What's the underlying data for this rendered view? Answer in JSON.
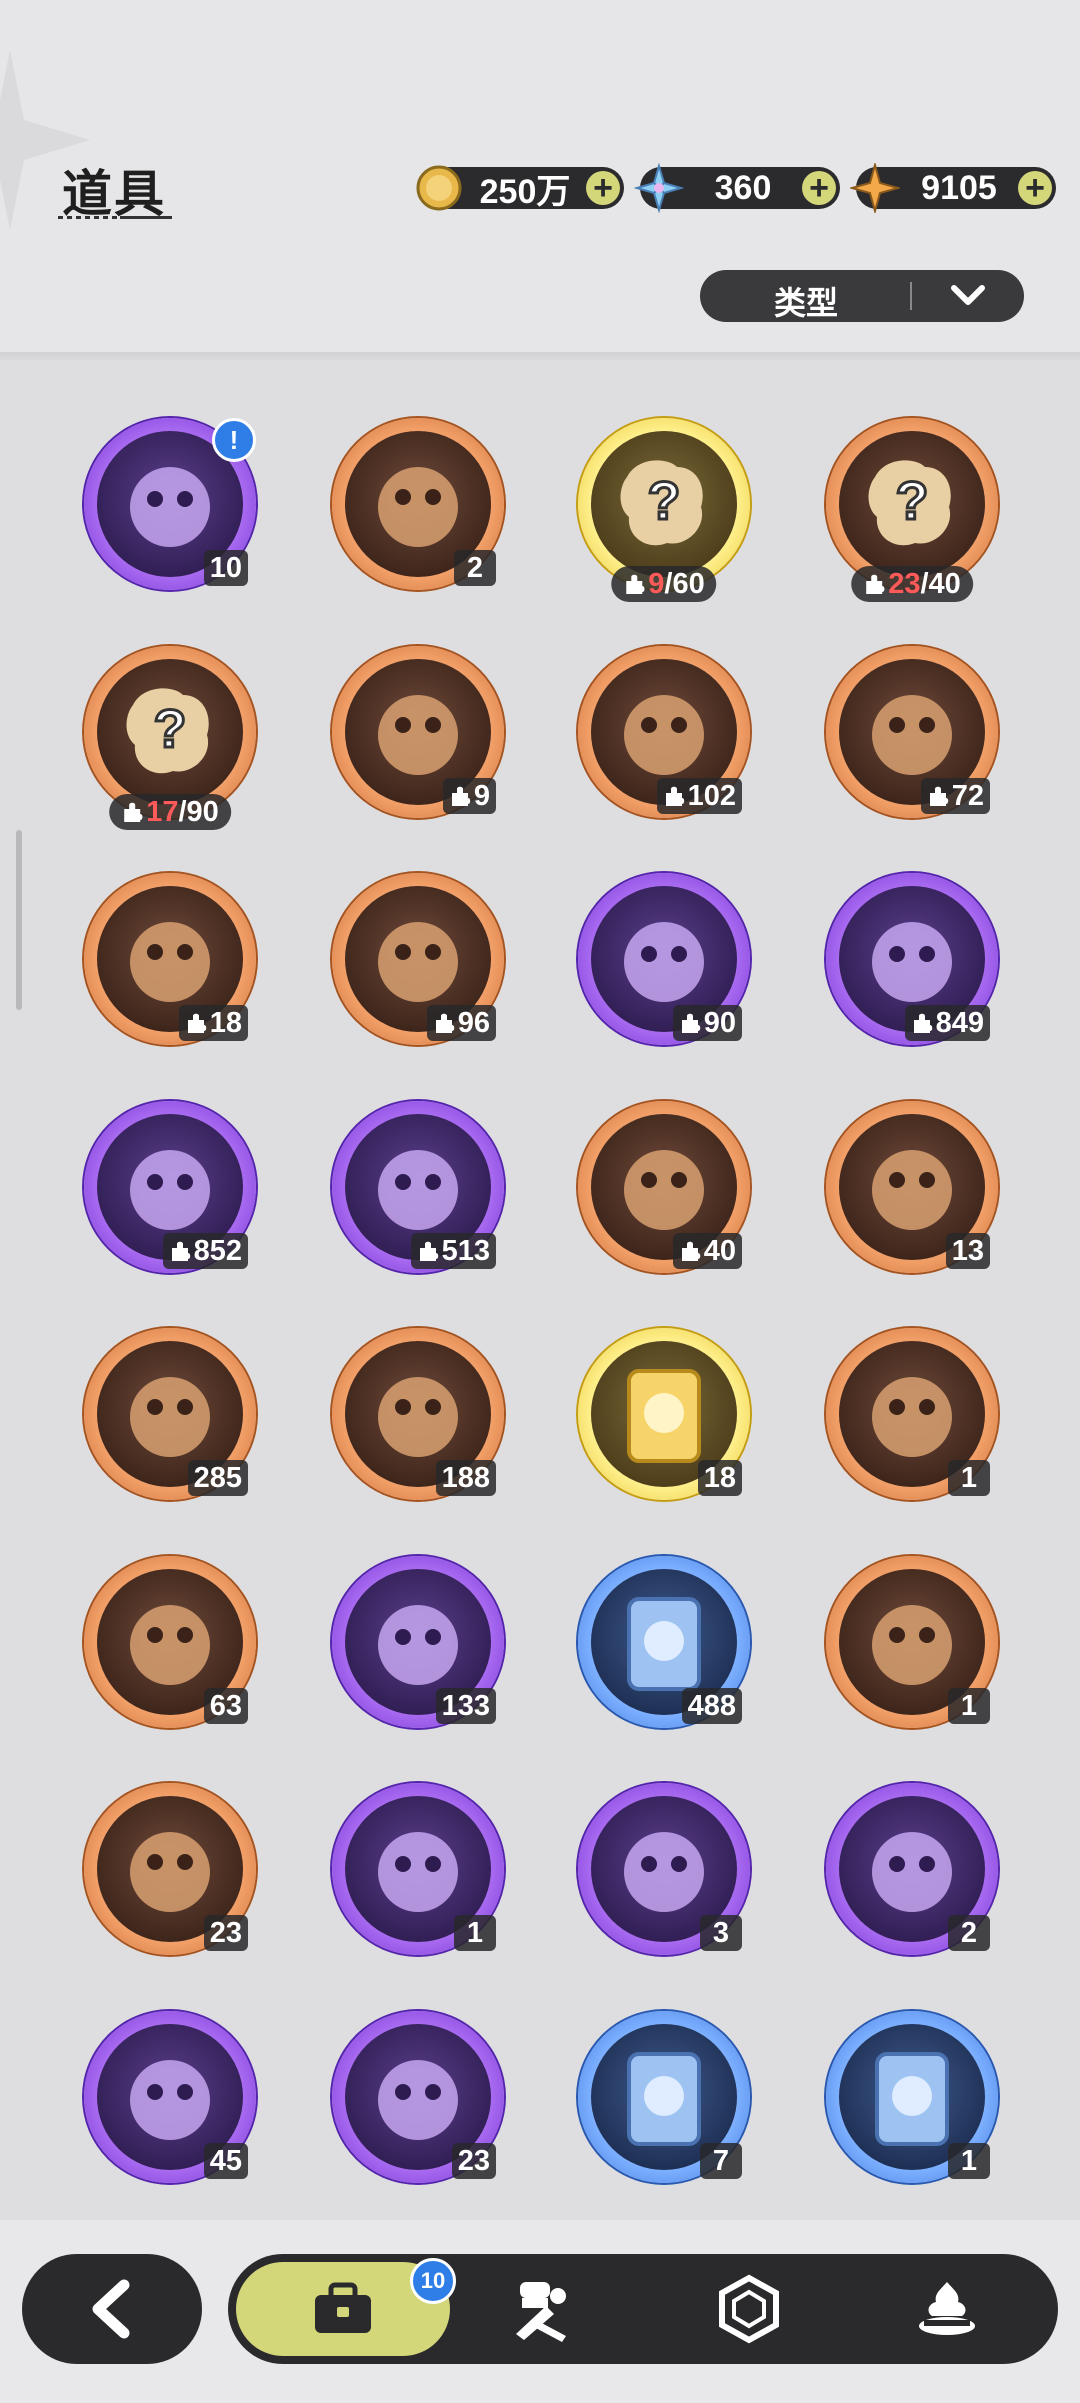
{
  "header": {
    "title": "道具",
    "currencies": [
      {
        "icon": "gold-coin-icon",
        "value": "250万"
      },
      {
        "icon": "crystal-flower-icon",
        "value": "360"
      },
      {
        "icon": "gold-star-icon",
        "value": "9105"
      }
    ],
    "filter_label": "类型"
  },
  "items": [
    {
      "name": "music-chest",
      "rarity": "purple",
      "count": "10",
      "alert": "!"
    },
    {
      "name": "purple-crystal-shard",
      "rarity": "orange",
      "count": "2"
    },
    {
      "name": "mystery-fragment-gold",
      "rarity": "gold",
      "frag_have": "9",
      "frag_need": "/60"
    },
    {
      "name": "mystery-fragment-orange",
      "rarity": "orange",
      "frag_have": "23",
      "frag_need": "/40"
    },
    {
      "name": "mystery-fragment-brown",
      "rarity": "orange",
      "frag_have": "17",
      "frag_need": "/90"
    },
    {
      "name": "teddy-fragment",
      "rarity": "orange",
      "count": "9",
      "puzzle": true
    },
    {
      "name": "knight-fragment",
      "rarity": "orange",
      "count": "102",
      "puzzle": true
    },
    {
      "name": "white-cat-fragment",
      "rarity": "orange",
      "count": "72",
      "puzzle": true
    },
    {
      "name": "dark-bear-fragment",
      "rarity": "orange",
      "count": "18",
      "puzzle": true
    },
    {
      "name": "lilac-mouse-fragment",
      "rarity": "orange",
      "count": "96",
      "puzzle": true
    },
    {
      "name": "shadow-cat-fragment",
      "rarity": "purple",
      "count": "90",
      "puzzle": true
    },
    {
      "name": "frog-bear-fragment",
      "rarity": "purple",
      "count": "849",
      "puzzle": true
    },
    {
      "name": "brown-bear-fragment",
      "rarity": "purple",
      "count": "852",
      "puzzle": true
    },
    {
      "name": "chick-fragment",
      "rarity": "purple",
      "count": "513",
      "puzzle": true
    },
    {
      "name": "tiger-fragment",
      "rarity": "orange",
      "count": "40",
      "puzzle": true
    },
    {
      "name": "pink-star-crystal",
      "rarity": "orange",
      "count": "13"
    },
    {
      "name": "blue-star-crystal",
      "rarity": "orange",
      "count": "285"
    },
    {
      "name": "paw-medallion",
      "rarity": "orange",
      "count": "188"
    },
    {
      "name": "gold-character-card",
      "rarity": "gold",
      "count": "18"
    },
    {
      "name": "rainbow-character-card",
      "rarity": "orange",
      "count": "1"
    },
    {
      "name": "orange-character-card",
      "rarity": "orange",
      "count": "63"
    },
    {
      "name": "purple-character-card",
      "rarity": "purple",
      "count": "133"
    },
    {
      "name": "blue-character-card",
      "rarity": "blue",
      "count": "488"
    },
    {
      "name": "swap-card",
      "rarity": "orange",
      "count": "1"
    },
    {
      "name": "clover-card",
      "rarity": "orange",
      "count": "23"
    },
    {
      "name": "gift-box",
      "rarity": "purple",
      "count": "1"
    },
    {
      "name": "gold-pouch",
      "rarity": "purple",
      "count": "3"
    },
    {
      "name": "magic-mirror",
      "rarity": "purple",
      "count": "2"
    },
    {
      "name": "scroll",
      "rarity": "purple",
      "count": "45"
    },
    {
      "name": "peach",
      "rarity": "purple",
      "count": "23"
    },
    {
      "name": "shovel",
      "rarity": "blue",
      "count": "7"
    },
    {
      "name": "boxing-glove",
      "rarity": "blue",
      "count": "1"
    }
  ],
  "nav": {
    "back_icon": "back-arrow-icon",
    "tabs": [
      {
        "icon": "bag-icon",
        "badge": "10",
        "active": true
      },
      {
        "icon": "chef-tools-icon"
      },
      {
        "icon": "hexagon-icon"
      },
      {
        "icon": "dessert-icon"
      }
    ]
  },
  "colors": {
    "orange_ring": "#f2a069",
    "purple_ring": "#a86af0",
    "gold_ring": "#fff08c",
    "blue_ring": "#7db0ff",
    "accent": "#d4d67a",
    "badge_blue": "#2f7ee8",
    "fragment_red": "#ff5a5a"
  }
}
